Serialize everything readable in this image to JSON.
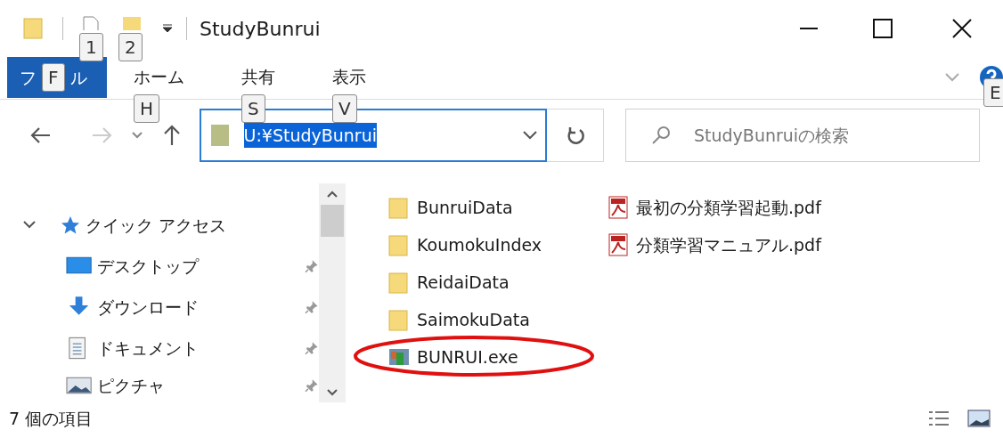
{
  "window": {
    "title": "StudyBunrui"
  },
  "quick_access_toolbar": {
    "keytips": [
      "1",
      "2"
    ]
  },
  "ribbon_tabs": [
    {
      "kind": "file",
      "parts": [
        "フ",
        "ル"
      ],
      "keytip": "F",
      "selected": true
    },
    {
      "kind": "tab",
      "label": "ホーム",
      "keytip": "H",
      "selected": false
    },
    {
      "kind": "tab",
      "label": "共有",
      "keytip": "S",
      "selected": false
    },
    {
      "kind": "tab",
      "label": "表示",
      "keytip": "V",
      "selected": false
    }
  ],
  "help_keytip": "E",
  "address": {
    "value": "U:¥StudyBunrui",
    "selected": true
  },
  "search": {
    "placeholder": "StudyBunruiの検索"
  },
  "navigation": {
    "label": "クイック アクセス",
    "expanded": true,
    "children": [
      {
        "label": "デスクトップ",
        "kind": "desktop",
        "pinned": true
      },
      {
        "label": "ダウンロード",
        "kind": "download",
        "pinned": true
      },
      {
        "label": "ドキュメント",
        "kind": "document",
        "pinned": true
      },
      {
        "label": "ピクチャ",
        "kind": "pictures",
        "pinned": true
      }
    ]
  },
  "files": [
    {
      "name": "BunruiData",
      "kind": "folder",
      "circled": false
    },
    {
      "name": "KoumokuIndex",
      "kind": "folder",
      "circled": false
    },
    {
      "name": "ReidaiData",
      "kind": "folder",
      "circled": false
    },
    {
      "name": "SaimokuData",
      "kind": "folder",
      "circled": false
    },
    {
      "name": "BUNRUI.exe",
      "kind": "exe",
      "circled": true
    },
    {
      "name": "最初の分類学習起動.pdf",
      "kind": "pdf",
      "circled": false
    },
    {
      "name": "分類学習マニュアル.pdf",
      "kind": "pdf",
      "circled": false
    }
  ],
  "status_bar": {
    "item_count": "7 個の項目"
  }
}
